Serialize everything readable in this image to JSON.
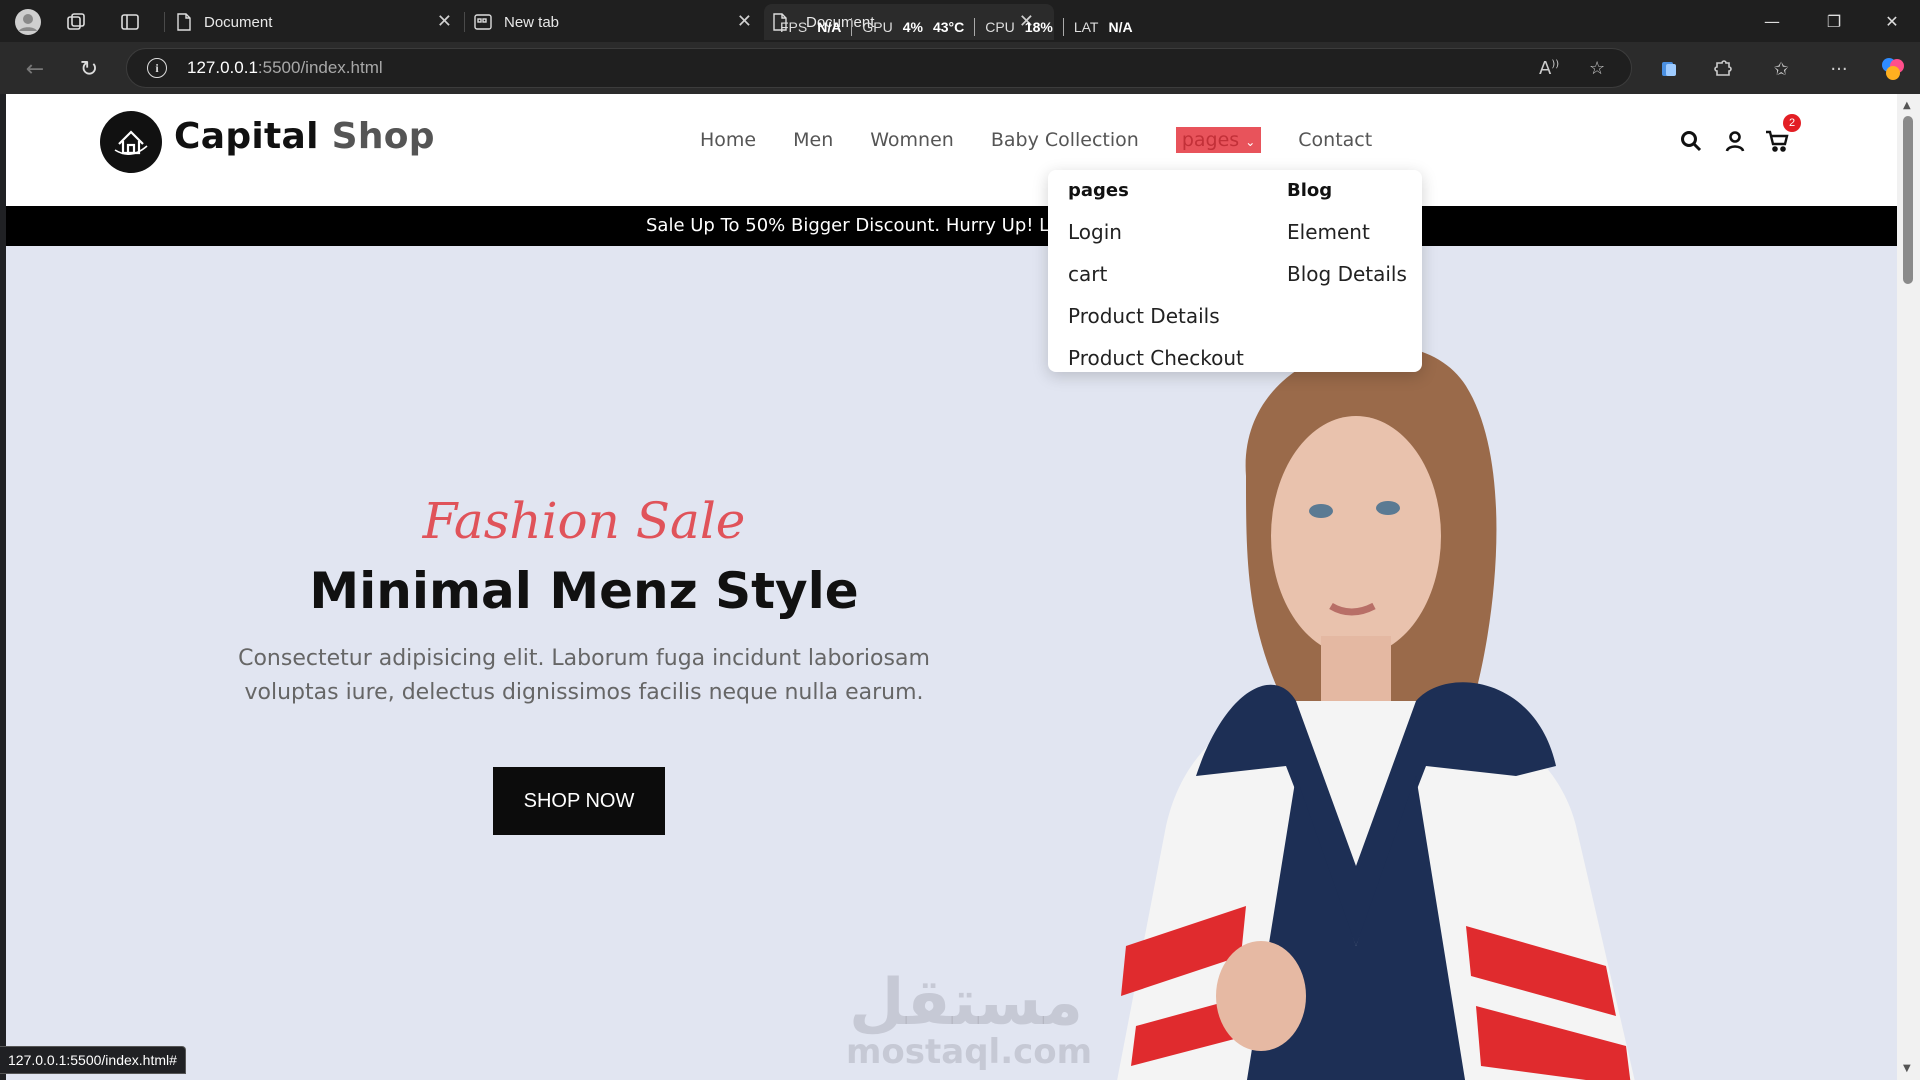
{
  "browser": {
    "tabs": [
      {
        "title": "Document"
      },
      {
        "title": "New tab"
      },
      {
        "title": "Document"
      }
    ],
    "overlay": {
      "fps_label": "FPS",
      "fps_value": "N/A",
      "gpu_label": "GPU",
      "gpu_value": "4%",
      "gpu_temp": "43°C",
      "cpu_label": "CPU",
      "cpu_value": "18%",
      "lat_label": "LAT",
      "lat_value": "N/A"
    },
    "url_host": "127.0.0.1",
    "url_rest": ":5500/index.html",
    "status_url": "127.0.0.1:5500/index.html#"
  },
  "site": {
    "logo_main": "Capital",
    "logo_secondary": "Shop",
    "nav": [
      {
        "label": "Home"
      },
      {
        "label": "Men"
      },
      {
        "label": "Womnen"
      },
      {
        "label": "Baby Collection"
      },
      {
        "label": "pages"
      },
      {
        "label": "Contact"
      }
    ],
    "cart_count": "2",
    "promo": "Sale Up To 50% Bigger Discount. Hurry Up! Li",
    "dropdown": {
      "col1_head": "pages",
      "col1_items": [
        "Login",
        "cart",
        "Product Details",
        "Product Checkout"
      ],
      "col2_head": "Blog",
      "col2_items": [
        "Element",
        "Blog Details"
      ]
    },
    "hero": {
      "subtitle": "Fashion Sale",
      "title": "Minimal Menz Style",
      "description": "Consectetur adipisicing elit. Laborum fuga incidunt laboriosam voluptas iure, delectus dignissimos facilis neque nulla earum.",
      "cta": "SHOP NOW"
    },
    "watermark_ar": "مستقل",
    "watermark_en": "mostaql.com"
  },
  "colors": {
    "accent": "#e8535b",
    "hero_bg": "#e1e5f1",
    "promo_bg": "#000000"
  }
}
